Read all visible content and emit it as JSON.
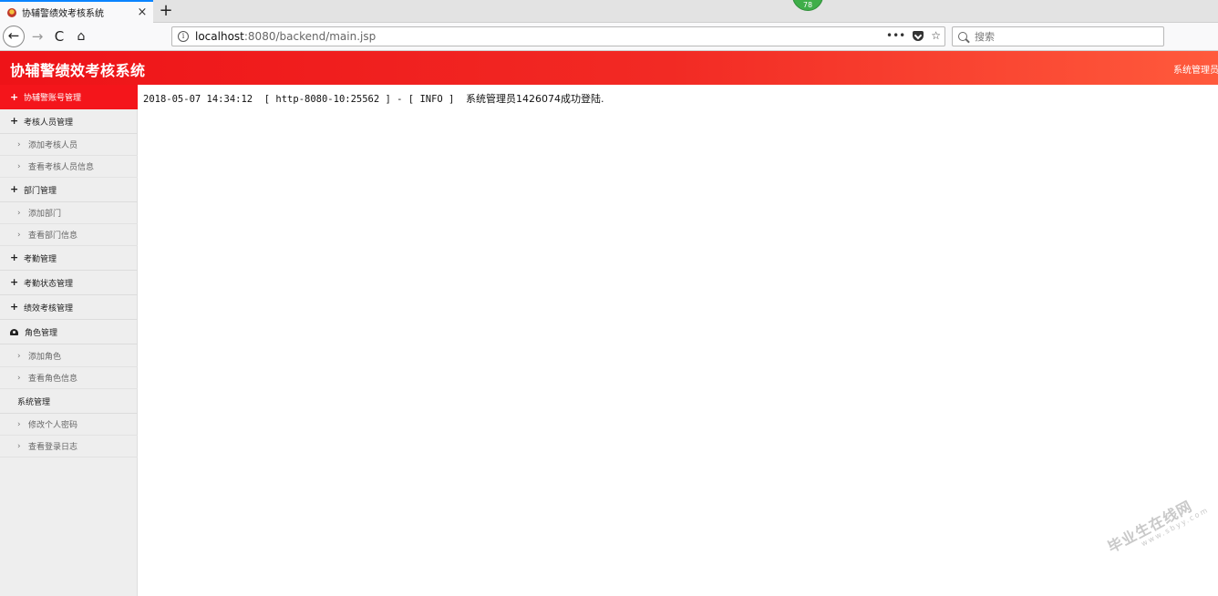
{
  "browser": {
    "tab_title": "协辅警绩效考核系统",
    "tab_close": "×",
    "new_tab": "+",
    "badge": "78",
    "back": "←",
    "forward": "→",
    "reload": "C",
    "home": "⌂",
    "url_host": "localhost",
    "url_path": ":8080/backend/main.jsp",
    "url_info": "i",
    "url_more": "•••",
    "url_star": "☆",
    "search_placeholder": "搜索"
  },
  "header": {
    "title": "协辅警绩效考核系统",
    "user": "系统管理员"
  },
  "sidebar": {
    "items": [
      {
        "type": "group",
        "icon": "plus-icon",
        "label": "协辅警账号管理",
        "active": true
      },
      {
        "type": "group",
        "icon": "plus-icon",
        "label": "考核人员管理"
      },
      {
        "type": "sub",
        "label": "添加考核人员"
      },
      {
        "type": "sub",
        "label": "查看考核人员信息"
      },
      {
        "type": "group",
        "icon": "plus-icon",
        "label": "部门管理"
      },
      {
        "type": "sub",
        "label": "添加部门"
      },
      {
        "type": "sub",
        "label": "查看部门信息"
      },
      {
        "type": "group",
        "icon": "plus-icon",
        "label": "考勤管理"
      },
      {
        "type": "group",
        "icon": "plus-icon",
        "label": "考勤状态管理"
      },
      {
        "type": "group",
        "icon": "plus-icon",
        "label": "绩效考核管理"
      },
      {
        "type": "group",
        "icon": "dashboard-icon",
        "label": "角色管理"
      },
      {
        "type": "sub",
        "label": "添加角色"
      },
      {
        "type": "sub",
        "label": "查看角色信息"
      },
      {
        "type": "group",
        "icon": "none",
        "label": "系统管理"
      },
      {
        "type": "sub",
        "label": "修改个人密码"
      },
      {
        "type": "sub",
        "label": "查看登录日志"
      }
    ]
  },
  "log": {
    "timestamp": "2018-05-07 14:34:12",
    "thread": "[ http-8080-10:25562 ] - [ INFO ]",
    "message": "系统管理员1426074成功登陆."
  },
  "watermark": {
    "main": "毕业生在线网",
    "sub": "www.sbyy.com"
  }
}
